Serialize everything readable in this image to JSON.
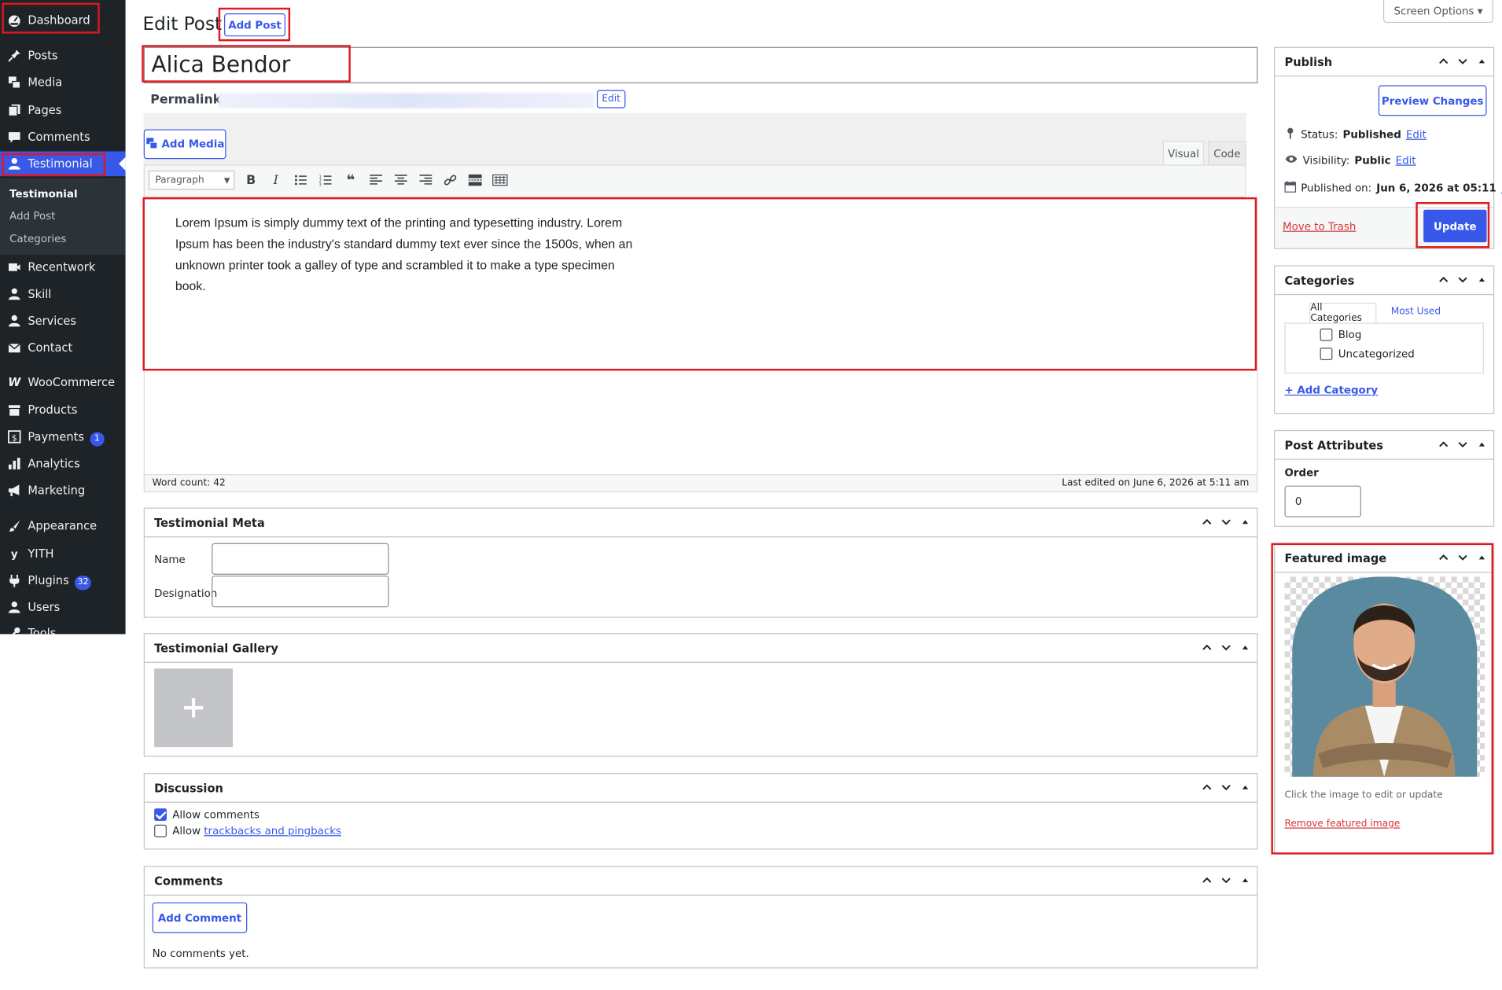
{
  "sidebar": {
    "items": [
      {
        "label": "Dashboard",
        "icon": "dashboard-icon"
      },
      {
        "label": "Posts",
        "icon": "pin-icon"
      },
      {
        "label": "Media",
        "icon": "media-icon"
      },
      {
        "label": "Pages",
        "icon": "pages-icon"
      },
      {
        "label": "Comments",
        "icon": "comment-icon"
      },
      {
        "label": "Testimonial",
        "icon": "user-icon"
      },
      {
        "label": "Recentwork",
        "icon": "video-icon"
      },
      {
        "label": "Skill",
        "icon": "user-icon"
      },
      {
        "label": "Services",
        "icon": "user-icon"
      },
      {
        "label": "Contact",
        "icon": "mail-icon"
      },
      {
        "label": "WooCommerce",
        "icon": "woo-icon"
      },
      {
        "label": "Products",
        "icon": "archive-icon"
      },
      {
        "label": "Payments",
        "icon": "dollar-icon",
        "badge": "1"
      },
      {
        "label": "Analytics",
        "icon": "chart-icon"
      },
      {
        "label": "Marketing",
        "icon": "megaphone-icon"
      },
      {
        "label": "Appearance",
        "icon": "brush-icon"
      },
      {
        "label": "YITH",
        "icon": "yith-icon"
      },
      {
        "label": "Plugins",
        "icon": "plugin-icon",
        "badge": "32"
      },
      {
        "label": "Users",
        "icon": "user-icon"
      },
      {
        "label": "Tools",
        "icon": "wrench-icon"
      }
    ],
    "submenu": [
      "Testimonial",
      "Add Post",
      "Categories"
    ]
  },
  "header": {
    "title": "Edit Post",
    "add_post": "Add Post",
    "screen_options": "Screen Options ▾"
  },
  "editor": {
    "post_title": "Alica Bendor",
    "permalink_label": "Permalink:",
    "permalink_edit": "Edit",
    "add_media": "Add Media",
    "tab_visual": "Visual",
    "tab_code": "Code",
    "format_select": "Paragraph",
    "content": "Lorem Ipsum is simply dummy text of the printing and typesetting industry. Lorem Ipsum has been the industry's standard dummy text ever since the 1500s, when an unknown printer took a galley of type and scrambled it to make a type specimen book.",
    "word_count": "Word count: 42",
    "last_edited": "Last edited on June 6, 2026 at 5:11 am"
  },
  "testimonial_meta": {
    "title": "Testimonial Meta",
    "name_label": "Name",
    "designation_label": "Designation"
  },
  "testimonial_gallery": {
    "title": "Testimonial Gallery"
  },
  "discussion": {
    "title": "Discussion",
    "allow_comments": "Allow comments",
    "allow_prefix": "Allow",
    "trackbacks": "trackbacks and pingbacks"
  },
  "comments": {
    "title": "Comments",
    "add_comment": "Add Comment",
    "empty": "No comments yet."
  },
  "publish": {
    "title": "Publish",
    "preview": "Preview Changes",
    "status_label": "Status:",
    "status_value": "Published",
    "visibility_label": "Visibility:",
    "visibility_value": "Public",
    "published_label": "Published on:",
    "published_value": "Jun 6, 2026 at 05:11",
    "edit": "Edit",
    "trash": "Move to Trash",
    "update": "Update"
  },
  "categories": {
    "title": "Categories",
    "tab_all": "All Categories",
    "tab_most": "Most Used",
    "items": [
      "Blog",
      "Uncategorized"
    ],
    "add": "+ Add Category"
  },
  "post_attributes": {
    "title": "Post Attributes",
    "order_label": "Order",
    "order_value": "0"
  },
  "featured_image": {
    "title": "Featured image",
    "hint": "Click the image to edit or update",
    "remove": "Remove featured image"
  },
  "colors": {
    "accent": "#3858e9",
    "highlight": "#e0181e",
    "sidebar": "#1d2327"
  }
}
